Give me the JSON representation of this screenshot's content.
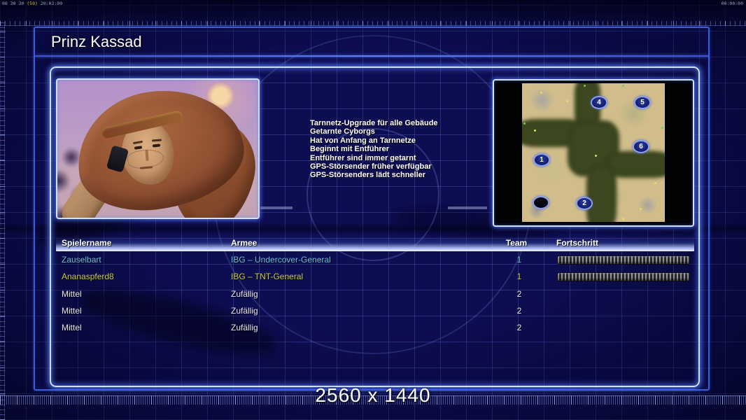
{
  "status_bar": {
    "left_counter_a": "08 30 30",
    "left_counter_b": "(59)",
    "left_counter_c": "20:02:00",
    "right_timer": "00:00:00"
  },
  "header": {
    "title": "Prinz Kassad"
  },
  "general_traits": [
    "Tarnnetz-Upgrade für alle Gebäude",
    "Getarnte Cyborgs",
    "Hat von Anfang an Tarnnetze",
    "Beginnt mit Entführer",
    "Entführer sind immer getarnt",
    "GPS-Störsender früher verfügbar",
    "GPS-Störsenders lädt schneller"
  ],
  "minimap": {
    "markers": [
      {
        "label": "1"
      },
      {
        "label": "2"
      },
      {
        "label": "4"
      },
      {
        "label": "5"
      },
      {
        "label": "6"
      },
      {
        "label": ""
      }
    ]
  },
  "table": {
    "headers": {
      "name": "Spielername",
      "army": "Armee",
      "team": "Team",
      "progress": "Fortschritt"
    },
    "rows": [
      {
        "name": "Zauselbart",
        "army": "IBG – Undercover-General",
        "team": "1"
      },
      {
        "name": "Ananaspferd8",
        "army": "IBG – TNT-General",
        "team": "1"
      },
      {
        "name": "Mittel",
        "army": "Zufällig",
        "team": "2"
      },
      {
        "name": "Mittel",
        "army": "Zufällig",
        "team": "2"
      },
      {
        "name": "Mittel",
        "army": "Zufällig",
        "team": "2"
      }
    ]
  },
  "footer": {
    "resolution": "2560 x 1440"
  },
  "colors": {
    "player1_text": "#62c2e0",
    "player2_text": "#cbcb3e",
    "neutral_text": "#e8e8f0",
    "frame_border": "#3c5cd8",
    "glow_border": "#cfe0ff",
    "background": "#0f0f5a"
  }
}
